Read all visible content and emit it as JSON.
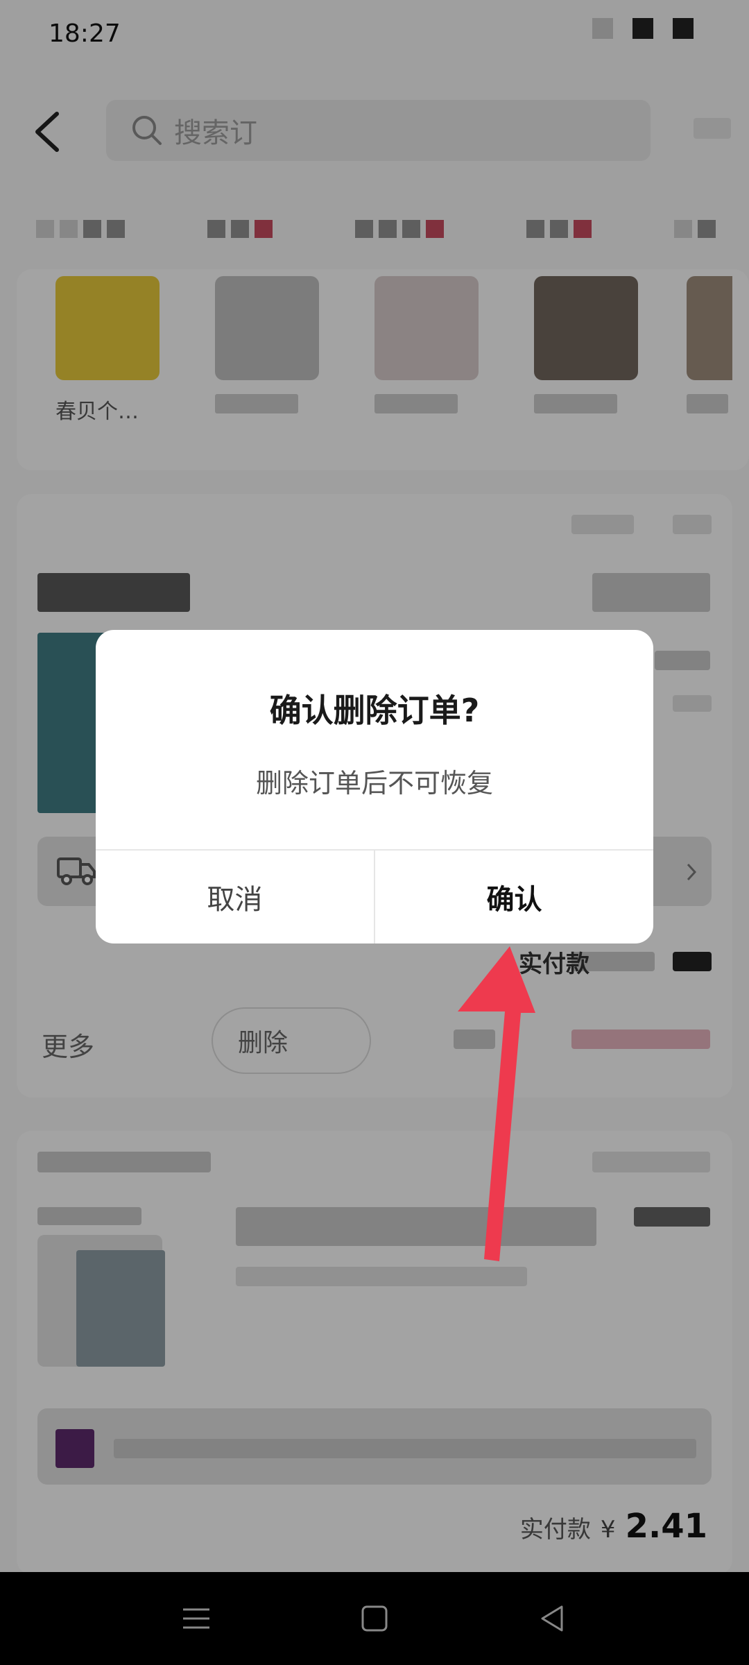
{
  "status_bar": {
    "time": "18:27"
  },
  "search": {
    "placeholder": "搜索订"
  },
  "recommendations": [
    {
      "label": "春贝个…",
      "color": "#e3c53a"
    },
    {
      "label": "",
      "color": "#c0c0c0"
    },
    {
      "label": "",
      "color": "#c65a5a"
    },
    {
      "label": "",
      "color": "#7a6a5c"
    },
    {
      "label": "",
      "color": "#9c8a7a"
    }
  ],
  "order": {
    "more_label": "更多",
    "delete_button": "删除",
    "actual_pay_label": "实付款"
  },
  "order2": {
    "total_label": "实付款",
    "currency": "¥",
    "total_amount": "2.41"
  },
  "dialog": {
    "title": "确认删除订单?",
    "message": "删除订单后不可恢复",
    "cancel_label": "取消",
    "confirm_label": "确认"
  },
  "colors": {
    "arrow": "#ee3a4e",
    "accent": "#d0506a"
  }
}
